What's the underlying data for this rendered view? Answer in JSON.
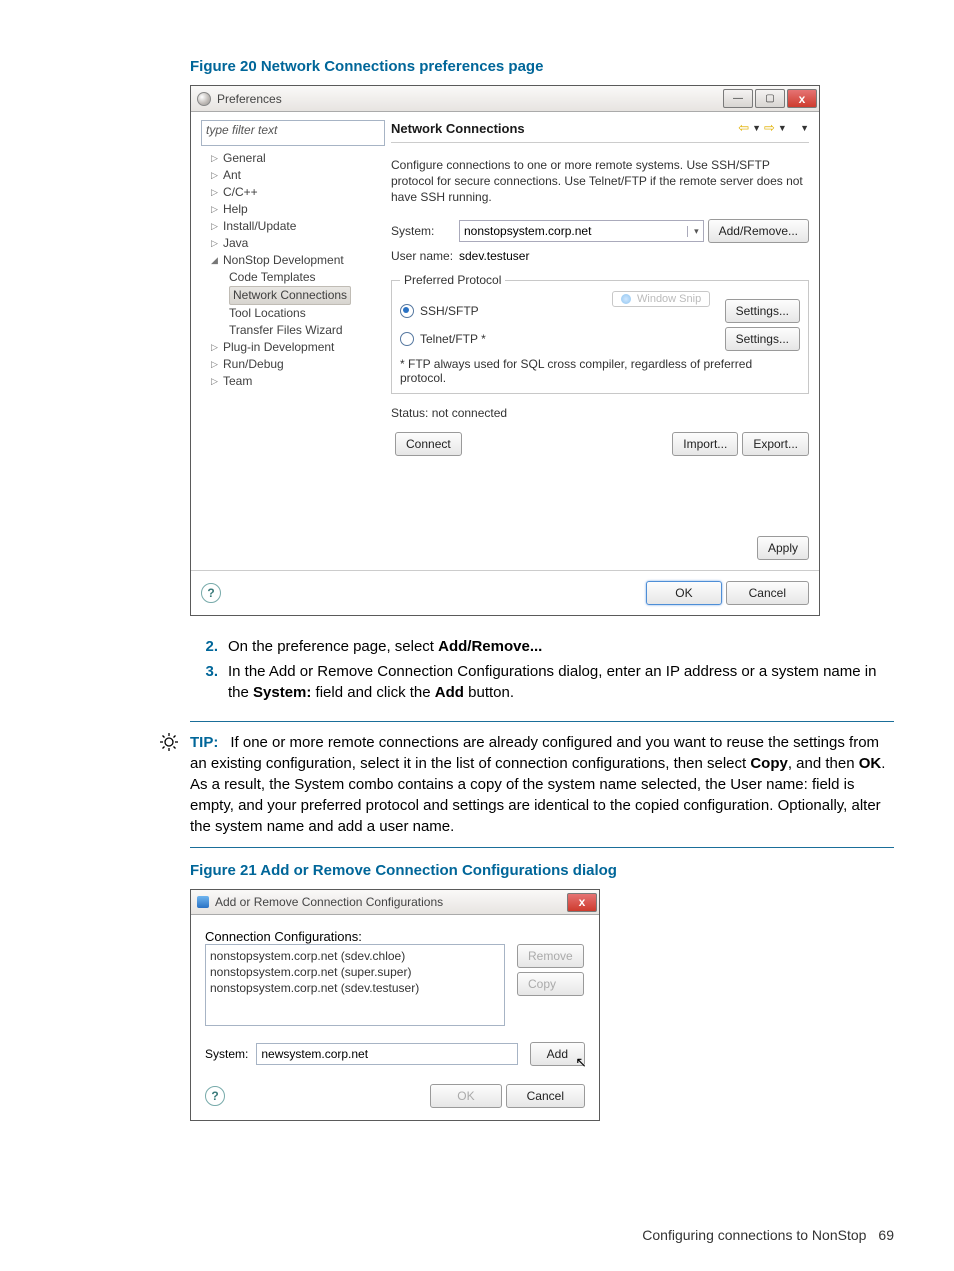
{
  "figure20_caption": "Figure 20 Network Connections preferences page",
  "prefs": {
    "window_title": "Preferences",
    "filter_placeholder": "type filter text",
    "tree": {
      "general": "General",
      "ant": "Ant",
      "ccpp": "C/C++",
      "help": "Help",
      "install": "Install/Update",
      "java": "Java",
      "nonstop": "NonStop Development",
      "code_tpl": "Code Templates",
      "netconn": "Network Connections",
      "tool_loc": "Tool Locations",
      "tfw": "Transfer Files Wizard",
      "plugin": "Plug-in Development",
      "rundebug": "Run/Debug",
      "team": "Team"
    },
    "section_title": "Network Connections",
    "desc": "Configure connections to one or more remote systems. Use SSH/SFTP protocol for secure connections. Use Telnet/FTP if the remote server does not have SSH running.",
    "system_label": "System:",
    "system_value": "nonstopsystem.corp.net",
    "add_remove": "Add/Remove...",
    "user_label": "User name:",
    "user_value": "sdev.testuser",
    "pp_legend": "Preferred Protocol",
    "ssh": "SSH/SFTP",
    "telnet": "Telnet/FTP *",
    "snip": "Window Snip",
    "settings": "Settings...",
    "ftp_note": "* FTP always used for SQL cross compiler, regardless of preferred protocol.",
    "status": "Status: not connected",
    "connect": "Connect",
    "import": "Import...",
    "export": "Export...",
    "apply": "Apply",
    "ok": "OK",
    "cancel": "Cancel"
  },
  "steps": {
    "s2": {
      "num": "2.",
      "pre": "On the preference page, select ",
      "b": "Add/Remove...",
      "post": ""
    },
    "s3": {
      "num": "3.",
      "pre": "In the Add or Remove Connection Configurations dialog, enter an IP address or a system name in the ",
      "b1": "System:",
      "mid": " field and click the ",
      "b2": "Add",
      "post": " button."
    }
  },
  "tip": {
    "label": "TIP:",
    "t1": "If one or more remote connections are already configured and you want to reuse the settings from an existing configuration, select it in the list of connection configurations, then select ",
    "b1": "Copy",
    "t2": ", and then ",
    "b2": "OK",
    "t3": ". As a result, the System combo contains a copy of the system name selected, the User name: field is empty, and your preferred protocol and settings are identical to the copied configuration. Optionally, alter the system name and add a user name."
  },
  "figure21_caption": "Figure 21 Add or Remove Connection Configurations dialog",
  "dlg2": {
    "title": "Add or Remove Connection Configurations",
    "list_label": "Connection Configurations:",
    "items": {
      "i1": "nonstopsystem.corp.net (sdev.chloe)",
      "i2": "nonstopsystem.corp.net (super.super)",
      "i3": "nonstopsystem.corp.net (sdev.testuser)"
    },
    "remove": "Remove",
    "copy": "Copy",
    "sys_label": "System:",
    "sys_value": "newsystem.corp.net",
    "add": "Add",
    "ok": "OK",
    "cancel": "Cancel"
  },
  "footer": {
    "text": "Configuring connections to NonStop",
    "page": "69"
  }
}
